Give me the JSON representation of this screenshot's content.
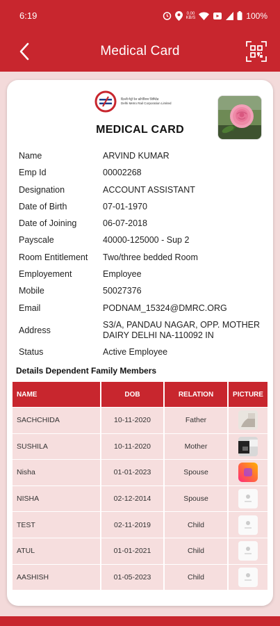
{
  "status_bar": {
    "time": "6:19",
    "network_speed": "0.00\nKB/S",
    "battery": "100%"
  },
  "header": {
    "title": "Medical Card",
    "back_icon": "chevron-left-icon",
    "qr_icon": "qr-scan-icon"
  },
  "card": {
    "org_name_hindi": "दिल्ली मेट्रो रेल कॉर्पोरेशन लिमिटेड",
    "org_name": "Delhi Metro Rail Corporation Limited",
    "title": "MEDICAL CARD",
    "fields": [
      {
        "label": "Name",
        "value": "ARVIND KUMAR"
      },
      {
        "label": "Emp Id",
        "value": "00002268"
      },
      {
        "label": "Designation",
        "value": "ACCOUNT ASSISTANT"
      },
      {
        "label": "Date of Birth",
        "value": "07-01-1970"
      },
      {
        "label": "Date of Joining",
        "value": "06-07-2018"
      },
      {
        "label": "Payscale",
        "value": "40000-125000 - Sup 2"
      },
      {
        "label": "Room Entitlement",
        "value": "Two/three bedded Room"
      },
      {
        "label": "Employement",
        "value": "Employee"
      },
      {
        "label": "Mobile",
        "value": "50027376"
      },
      {
        "label": "Email",
        "value": "PODNAM_15324@DMRC.ORG"
      },
      {
        "label": "Address",
        "value": "S3/A, PANDAU NAGAR, OPP. MOTHER DAIRY DELHI NA-110092 IN"
      },
      {
        "label": "Status",
        "value": "Active Employee"
      }
    ]
  },
  "dependents": {
    "section_title": "Details Dependent Family Members",
    "columns": [
      "NAME",
      "DOB",
      "RELATION",
      "PICTURE"
    ],
    "rows": [
      {
        "name": "SACHCHIDA",
        "dob": "10-11-2020",
        "relation": "Father",
        "picture": "photo"
      },
      {
        "name": "SUSHILA",
        "dob": "10-11-2020",
        "relation": "Mother",
        "picture": "photo-dark"
      },
      {
        "name": "Nisha",
        "dob": "01-01-2023",
        "relation": "Spouse",
        "picture": "gradient-app-icon"
      },
      {
        "name": "NISHA",
        "dob": "02-12-2014",
        "relation": "Spouse",
        "picture": "placeholder"
      },
      {
        "name": "TEST",
        "dob": "02-11-2019",
        "relation": "Child",
        "picture": "placeholder"
      },
      {
        "name": "ATUL",
        "dob": "01-01-2021",
        "relation": "Child",
        "picture": "placeholder"
      },
      {
        "name": "AASHISH",
        "dob": "01-05-2023",
        "relation": "Child",
        "picture": "placeholder"
      }
    ]
  },
  "colors": {
    "primary": "#c8262e",
    "row_bg": "#f6dede",
    "page_bg": "#f3dada"
  }
}
